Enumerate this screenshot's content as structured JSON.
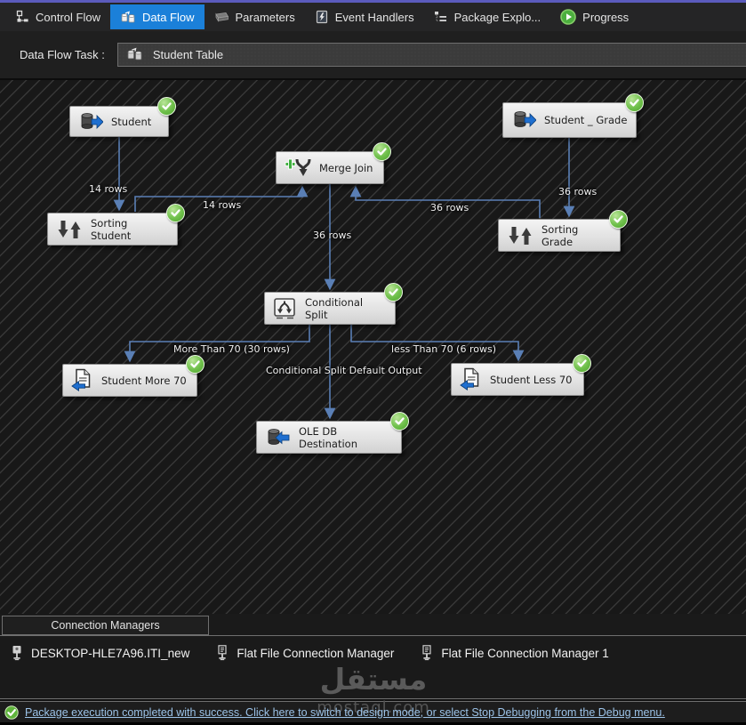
{
  "tabs": [
    {
      "label": "Control Flow",
      "selected": false
    },
    {
      "label": "Data Flow",
      "selected": true
    },
    {
      "label": "Parameters",
      "selected": false
    },
    {
      "label": "Event Handlers",
      "selected": false
    },
    {
      "label": "Package Explo...",
      "selected": false
    },
    {
      "label": "Progress",
      "selected": false
    }
  ],
  "task_selector": {
    "label": "Data Flow Task :",
    "value": "Student Table"
  },
  "canvas": {
    "nodes": [
      {
        "label": "Student",
        "type": "ole-db-source",
        "status": "success"
      },
      {
        "label": "Student _ Grade",
        "type": "ole-db-source",
        "status": "success"
      },
      {
        "label": "Merge Join",
        "type": "merge-join",
        "status": "success"
      },
      {
        "label": "Sorting Student",
        "type": "sort",
        "status": "success"
      },
      {
        "label": "Sorting Grade",
        "type": "sort",
        "status": "success"
      },
      {
        "label": "Conditional Split",
        "type": "conditional-split",
        "status": "success"
      },
      {
        "label": "Student More 70",
        "type": "flat-file-destination",
        "status": "success"
      },
      {
        "label": "Student Less 70",
        "type": "flat-file-destination",
        "status": "success"
      },
      {
        "label": "OLE DB Destination",
        "type": "ole-db-destination",
        "status": "success"
      }
    ],
    "edges": [
      {
        "from": "Student",
        "to": "Sorting Student",
        "label": "14 rows"
      },
      {
        "from": "Sorting Student",
        "to": "Merge Join",
        "label": "14 rows"
      },
      {
        "from": "Student _ Grade",
        "to": "Sorting Grade",
        "label": "36 rows"
      },
      {
        "from": "Sorting Grade",
        "to": "Merge Join",
        "label": "36 rows"
      },
      {
        "from": "Merge Join",
        "to": "Conditional Split",
        "label": "36 rows"
      },
      {
        "from": "Conditional Split",
        "to": "Student More 70",
        "label": "More Than 70 (30 rows)"
      },
      {
        "from": "Conditional Split",
        "to": "OLE DB Destination",
        "label": "Conditional Split Default Output"
      },
      {
        "from": "Conditional Split",
        "to": "Student Less 70",
        "label": "less Than 70 (6 rows)"
      }
    ]
  },
  "connection_managers": {
    "title": "Connection Managers",
    "items": [
      {
        "label": "DESKTOP-HLE7A96.ITI_new",
        "icon": "database-connection-icon"
      },
      {
        "label": "Flat File Connection Manager",
        "icon": "flat-file-connection-icon"
      },
      {
        "label": "Flat File Connection Manager 1",
        "icon": "flat-file-connection-icon"
      }
    ]
  },
  "status_bar": {
    "message": "Package execution completed with success. Click here to switch to design mode, or select Stop Debugging from the Debug menu."
  },
  "watermark": {
    "arabic": "مستقل",
    "domain": "mostaql.com"
  },
  "colors": {
    "debug_accent": "#5b5bbd",
    "selected_tab": "#1b80d9",
    "edge": "#5a7fb5",
    "success_green": "#5fb446",
    "status_link": "#9cc3e8"
  }
}
